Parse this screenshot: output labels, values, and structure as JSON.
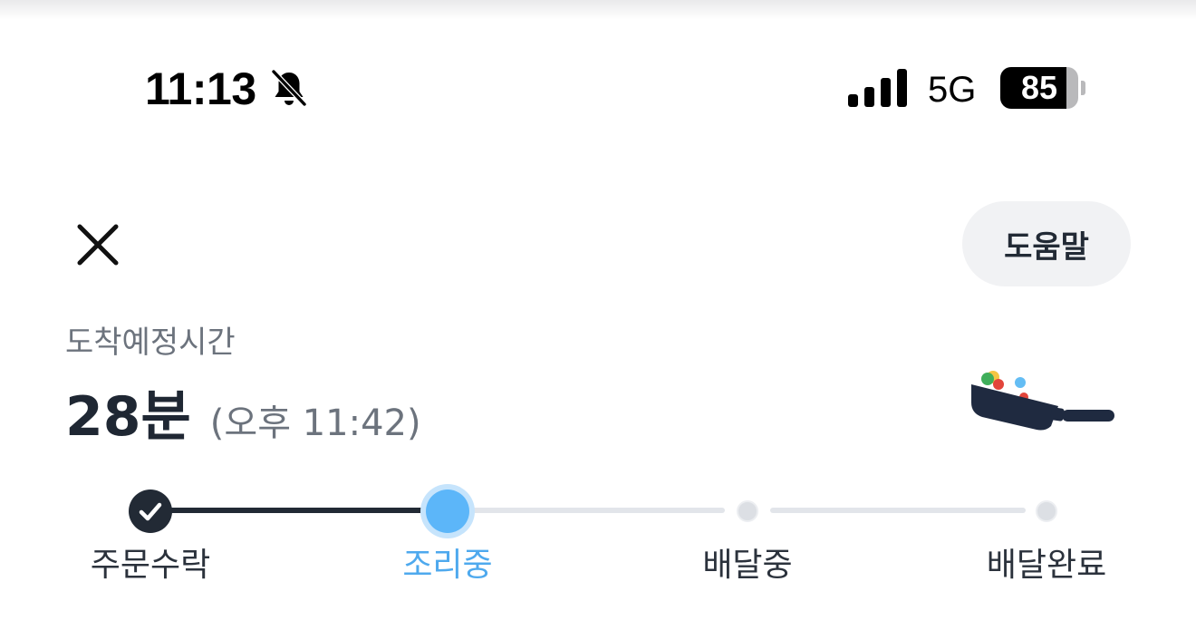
{
  "status_bar": {
    "time": "11:13",
    "network": "5G",
    "battery_percent": "85",
    "battery_level": 0.85,
    "icons": [
      "bell-slash-icon",
      "signal-bars-icon",
      "battery-icon"
    ]
  },
  "header": {
    "close_icon": "close-icon",
    "help_label": "도움말"
  },
  "eta": {
    "label": "도착예정시간",
    "minutes": "28분",
    "clock": "(오후 11:42)"
  },
  "illustration": "frying-pan-icon",
  "progress": {
    "current_step": 1,
    "steps": [
      {
        "label": "주문수락",
        "state": "done"
      },
      {
        "label": "조리중",
        "state": "current"
      },
      {
        "label": "배달중",
        "state": "pending"
      },
      {
        "label": "배달완료",
        "state": "pending"
      }
    ]
  },
  "colors": {
    "primary_text": "#1f2733",
    "secondary_text": "#6c737d",
    "accent_blue": "#4ea9ee",
    "done_dark": "#222a35",
    "pending_gray": "#dcdfe4"
  }
}
